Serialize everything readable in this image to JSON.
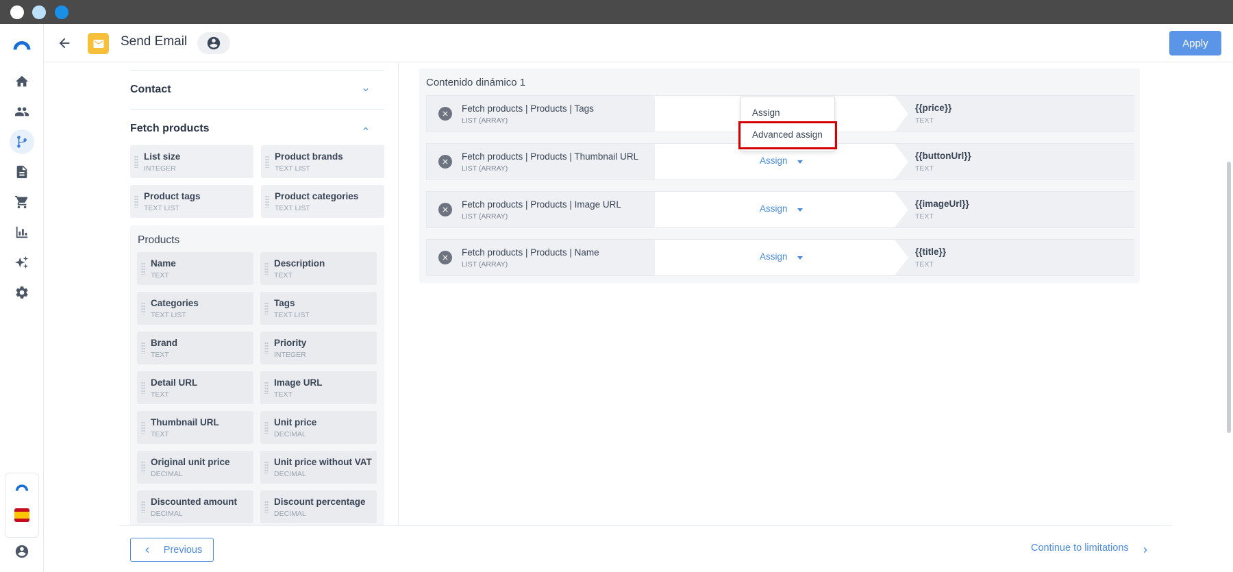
{
  "window": {
    "dots": [
      "#ffffff",
      "#bde0fa",
      "#1a8fe8"
    ]
  },
  "header": {
    "title": "Send Email",
    "apply_label": "Apply"
  },
  "nav": [
    "home-icon",
    "users-icon",
    "flows-icon",
    "document-icon",
    "cart-icon",
    "chart-icon",
    "sparkle-icon",
    "gear-icon"
  ],
  "left_panel": {
    "sections": [
      {
        "title": "Contact",
        "expanded": false
      },
      {
        "title": "Fetch products",
        "expanded": true
      }
    ],
    "fetch_fields": [
      {
        "name": "List size",
        "type": "INTEGER"
      },
      {
        "name": "Product brands",
        "type": "TEXT LIST"
      },
      {
        "name": "Product tags",
        "type": "TEXT LIST"
      },
      {
        "name": "Product categories",
        "type": "TEXT LIST"
      }
    ],
    "products_group": {
      "title": "Products",
      "fields": [
        {
          "name": "Name",
          "type": "TEXT"
        },
        {
          "name": "Description",
          "type": "TEXT"
        },
        {
          "name": "Categories",
          "type": "TEXT LIST"
        },
        {
          "name": "Tags",
          "type": "TEXT LIST"
        },
        {
          "name": "Brand",
          "type": "TEXT"
        },
        {
          "name": "Priority",
          "type": "INTEGER"
        },
        {
          "name": "Detail URL",
          "type": "TEXT"
        },
        {
          "name": "Image URL",
          "type": "TEXT"
        },
        {
          "name": "Thumbnail URL",
          "type": "TEXT"
        },
        {
          "name": "Unit price",
          "type": "DECIMAL"
        },
        {
          "name": "Original unit price",
          "type": "DECIMAL"
        },
        {
          "name": "Unit price without VAT",
          "type": "DECIMAL"
        },
        {
          "name": "Discounted amount",
          "type": "DECIMAL"
        },
        {
          "name": "Discount percentage",
          "type": "DECIMAL"
        }
      ]
    }
  },
  "mapping": {
    "title": "Contenido dinámico 1",
    "assign_label": "Assign",
    "rows": [
      {
        "source": "Fetch products | Products | Tags",
        "source_type": "LIST (ARRAY)",
        "target": "{{price}}",
        "target_type": "TEXT"
      },
      {
        "source": "Fetch products | Products | Thumbnail URL",
        "source_type": "LIST (ARRAY)",
        "target": "{{buttonUrl}}",
        "target_type": "TEXT"
      },
      {
        "source": "Fetch products | Products | Image URL",
        "source_type": "LIST (ARRAY)",
        "target": "{{imageUrl}}",
        "target_type": "TEXT"
      },
      {
        "source": "Fetch products | Products | Name",
        "source_type": "LIST (ARRAY)",
        "target": "{{title}}",
        "target_type": "TEXT"
      }
    ],
    "dropdown": {
      "options": [
        "Assign",
        "Advanced assign"
      ],
      "highlighted": "Advanced assign"
    }
  },
  "footer": {
    "previous_label": "Previous",
    "continue_label": "Continue to limitations"
  }
}
